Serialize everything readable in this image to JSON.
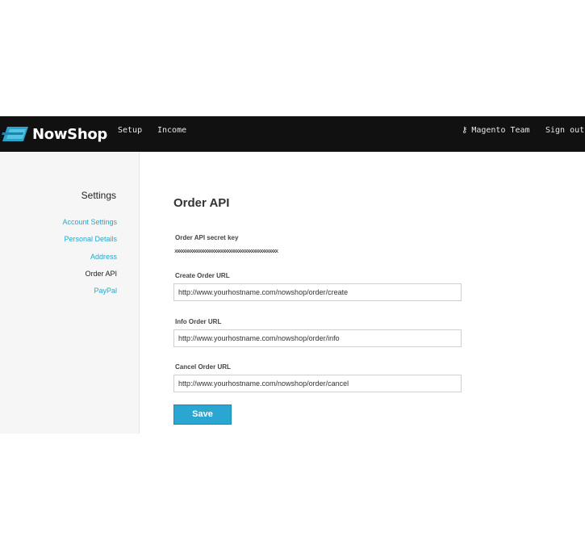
{
  "brand": {
    "name": "NowShop",
    "logo_icon": "ticket-logo-icon",
    "accent": "#29a6d1"
  },
  "nav": {
    "setup": "Setup",
    "income": "Income",
    "user_icon": "key-icon",
    "user": "Magento Team",
    "signout": "Sign out"
  },
  "sidebar": {
    "title": "Settings",
    "items": [
      {
        "label": "Account Settings",
        "active": false
      },
      {
        "label": "Personal Details",
        "active": false
      },
      {
        "label": "Address",
        "active": false
      },
      {
        "label": "Order API",
        "active": true
      },
      {
        "label": "PayPal",
        "active": false
      }
    ]
  },
  "main": {
    "title": "Order API",
    "secret": {
      "label": "Order API secret key",
      "value": "xxxxxxxxxxxxxxxxxxxxxxxxxxxxxxxxxxxxxxxxxxxxxxx"
    },
    "create": {
      "label": "Create Order URL",
      "value": "http://www.yourhostname.com/nowshop/order/create"
    },
    "info": {
      "label": "Info Order URL",
      "value": "http://www.yourhostname.com/nowshop/order/info"
    },
    "cancel": {
      "label": "Cancel Order URL",
      "value": "http://www.yourhostname.com/nowshop/order/cancel"
    },
    "save_label": "Save"
  }
}
